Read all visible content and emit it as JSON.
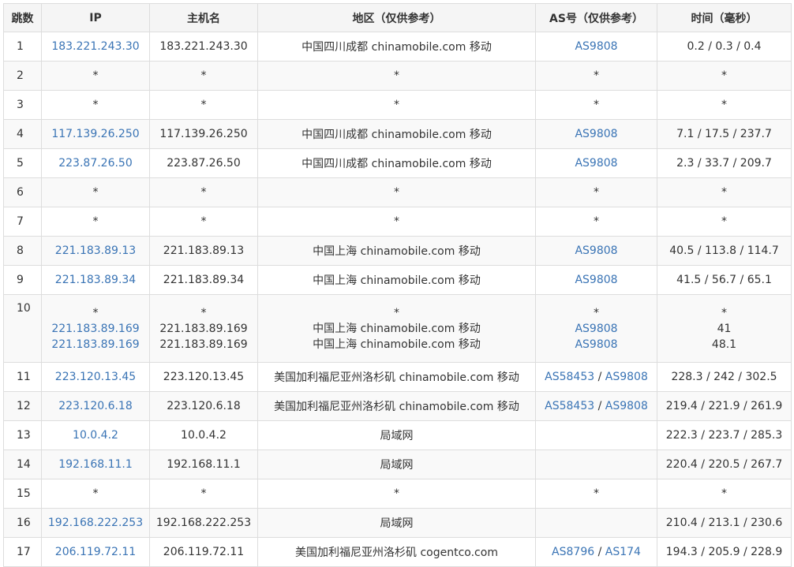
{
  "headers": {
    "hop": "跳数",
    "ip": "IP",
    "host": "主机名",
    "region": "地区（仅供参考）",
    "as": "AS号（仅供参考）",
    "time": "时间（毫秒）"
  },
  "rows": [
    {
      "hop": "1",
      "ip": "183.221.243.30",
      "host": "183.221.243.30",
      "region": "中国四川成都 chinamobile.com 移动",
      "as": [
        "AS9808"
      ],
      "time": "0.2 / 0.3 / 0.4"
    },
    {
      "hop": "2",
      "ip": "*",
      "host": "*",
      "region": "*",
      "as_text": "*",
      "time": "*"
    },
    {
      "hop": "3",
      "ip": "*",
      "host": "*",
      "region": "*",
      "as_text": "*",
      "time": "*"
    },
    {
      "hop": "4",
      "ip": "117.139.26.250",
      "host": "117.139.26.250",
      "region": "中国四川成都 chinamobile.com 移动",
      "as": [
        "AS9808"
      ],
      "time": "7.1 / 17.5 / 237.7"
    },
    {
      "hop": "5",
      "ip": "223.87.26.50",
      "host": "223.87.26.50",
      "region": "中国四川成都 chinamobile.com 移动",
      "as": [
        "AS9808"
      ],
      "time": "2.3 / 33.7 / 209.7"
    },
    {
      "hop": "6",
      "ip": "*",
      "host": "*",
      "region": "*",
      "as_text": "*",
      "time": "*"
    },
    {
      "hop": "7",
      "ip": "*",
      "host": "*",
      "region": "*",
      "as_text": "*",
      "time": "*"
    },
    {
      "hop": "8",
      "ip": "221.183.89.13",
      "host": "221.183.89.13",
      "region": "中国上海 chinamobile.com 移动",
      "as": [
        "AS9808"
      ],
      "time": "40.5 / 113.8 / 114.7"
    },
    {
      "hop": "9",
      "ip": "221.183.89.34",
      "host": "221.183.89.34",
      "region": "中国上海 chinamobile.com 移动",
      "as": [
        "AS9808"
      ],
      "time": "41.5 / 56.7 / 65.1"
    },
    {
      "hop": "10",
      "multi": [
        {
          "ip": "*",
          "host": "*",
          "region": "*",
          "as_text": "*",
          "time": "*"
        },
        {
          "ip": "221.183.89.169",
          "host": "221.183.89.169",
          "region": "中国上海 chinamobile.com 移动",
          "as": [
            "AS9808"
          ],
          "time": "41"
        },
        {
          "ip": "221.183.89.169",
          "host": "221.183.89.169",
          "region": "中国上海 chinamobile.com 移动",
          "as": [
            "AS9808"
          ],
          "time": "48.1"
        }
      ]
    },
    {
      "hop": "11",
      "ip": "223.120.13.45",
      "host": "223.120.13.45",
      "region": "美国加利福尼亚州洛杉矶 chinamobile.com 移动",
      "as": [
        "AS58453",
        "AS9808"
      ],
      "time": "228.3 / 242 / 302.5"
    },
    {
      "hop": "12",
      "ip": "223.120.6.18",
      "host": "223.120.6.18",
      "region": "美国加利福尼亚州洛杉矶 chinamobile.com 移动",
      "as": [
        "AS58453",
        "AS9808"
      ],
      "time": "219.4 / 221.9 / 261.9"
    },
    {
      "hop": "13",
      "ip": "10.0.4.2",
      "host": "10.0.4.2",
      "region": "局域网",
      "as": [],
      "time": "222.3 / 223.7 / 285.3"
    },
    {
      "hop": "14",
      "ip": "192.168.11.1",
      "host": "192.168.11.1",
      "region": "局域网",
      "as": [],
      "time": "220.4 / 220.5 / 267.7"
    },
    {
      "hop": "15",
      "ip": "*",
      "host": "*",
      "region": "*",
      "as_text": "*",
      "time": "*"
    },
    {
      "hop": "16",
      "ip": "192.168.222.253",
      "host": "192.168.222.253",
      "region": "局域网",
      "as": [],
      "time": "210.4 / 213.1 / 230.6"
    },
    {
      "hop": "17",
      "ip": "206.119.72.11",
      "host": "206.119.72.11",
      "region": "美国加利福尼亚州洛杉矶 cogentco.com",
      "as": [
        "AS8796",
        "AS174"
      ],
      "time": "194.3 / 205.9 / 228.9"
    }
  ],
  "as_separator": " / ",
  "colors": {
    "link": "#3a74b5",
    "text": "#333333",
    "border": "#dddddd",
    "header_bg": "#f5f5f5",
    "stripe_bg": "#f9f9f9"
  }
}
